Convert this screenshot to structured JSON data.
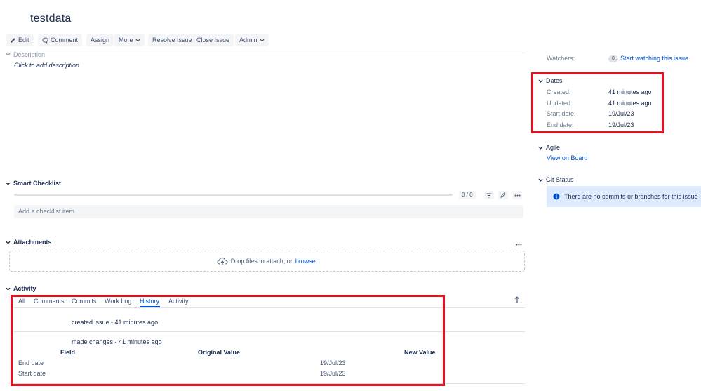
{
  "issue": {
    "title": "testdata"
  },
  "toolbar": {
    "edit": "Edit",
    "comment": "Comment",
    "assign": "Assign",
    "more": "More",
    "resolve": "Resolve Issue",
    "close": "Close Issue",
    "admin": "Admin"
  },
  "description": {
    "label": "Description",
    "placeholder": "Click to add description"
  },
  "smart_checklist": {
    "title": "Smart Checklist",
    "progress": "0 / 0",
    "progress_fraction": 0,
    "add_placeholder": "Add a checklist item"
  },
  "attachments": {
    "title": "Attachments",
    "drop_text": "Drop files to attach, or",
    "browse": "browse."
  },
  "activity": {
    "title": "Activity",
    "tabs": [
      "All",
      "Comments",
      "Commits",
      "Work Log",
      "History",
      "Activity"
    ],
    "active_tab": "History",
    "history": [
      {
        "text": "created issue - 41 minutes ago"
      },
      {
        "text": "made changes - 41 minutes ago",
        "columns": [
          "Field",
          "Original Value",
          "New Value"
        ],
        "rows": [
          {
            "field": "End date",
            "original": "",
            "new": "19/Jul/23"
          },
          {
            "field": "Start date",
            "original": "",
            "new": "19/Jul/23"
          }
        ]
      }
    ]
  },
  "sidebar": {
    "watchers": {
      "label": "Watchers:",
      "count": "0",
      "action": "Start watching this issue"
    },
    "dates": {
      "title": "Dates",
      "rows": [
        {
          "label": "Created:",
          "value": "41 minutes ago"
        },
        {
          "label": "Updated:",
          "value": "41 minutes ago"
        },
        {
          "label": "Start date:",
          "value": "19/Jul/23"
        },
        {
          "label": "End date:",
          "value": "19/Jul/23"
        }
      ]
    },
    "agile": {
      "title": "Agile",
      "link": "View on Board"
    },
    "git": {
      "title": "Git Status",
      "message": "There are no commits or branches for this issue"
    }
  },
  "colors": {
    "highlight": "#e8101f",
    "link": "#0052cc",
    "info_bg": "#deebff"
  }
}
